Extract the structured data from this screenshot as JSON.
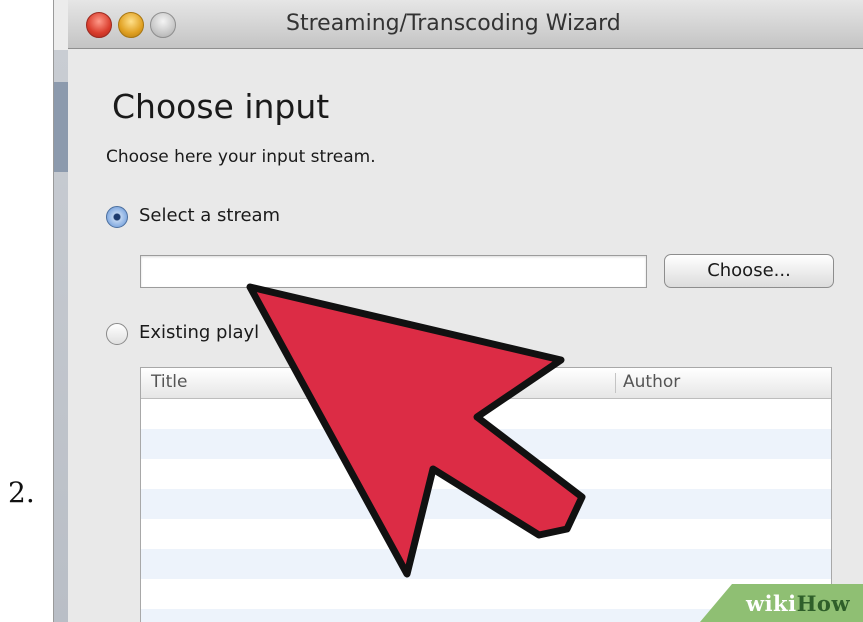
{
  "step": {
    "number": "2."
  },
  "window": {
    "title": "Streaming/Transcoding Wizard"
  },
  "wizard": {
    "heading": "Choose input",
    "subheading": "Choose here your input stream.",
    "options": [
      {
        "label": "Select a stream",
        "selected": true
      },
      {
        "label": "Existing playl",
        "selected": false
      }
    ],
    "stream_input": {
      "value": "",
      "placeholder": ""
    },
    "choose_button": "Choose...",
    "table": {
      "columns": [
        "Title",
        "Author"
      ],
      "rows": []
    }
  },
  "watermark": {
    "part1": "wiki",
    "part2": "How"
  },
  "colors": {
    "arrow": "#dc2c45",
    "arrow_outline": "#111111",
    "row_alt": "#edf3fb"
  }
}
